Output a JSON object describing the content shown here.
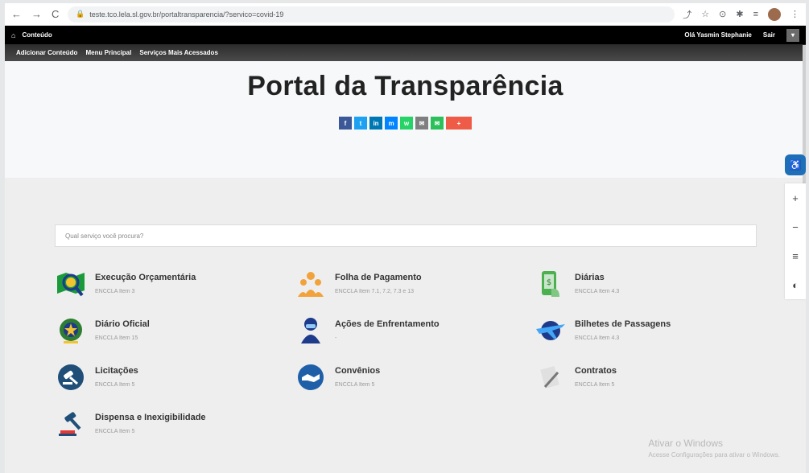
{
  "browser": {
    "back": "←",
    "forward": "→",
    "reload": "C",
    "lock": "🔒",
    "url": "teste.tco.lela.sl.gov.br/portaltransparencia/?servico=covid-19",
    "tool_icons": [
      "⤴",
      "☆",
      "⊙",
      "✱",
      "≡"
    ],
    "menu": "⋮"
  },
  "adminbar": {
    "home_icon": "⌂",
    "conteudo": "Conteúdo",
    "greeting": "Olá Yasmin Stephanie",
    "sair": "Sair",
    "toggle": "▾"
  },
  "submenu": {
    "items": [
      "Adicionar Conteúdo",
      "Menu Principal",
      "Serviços Mais Acessados"
    ]
  },
  "hero": {
    "title": "Portal da Transparência",
    "share_buttons": [
      {
        "label": "f",
        "color": "#3b5998"
      },
      {
        "label": "t",
        "color": "#1da1f2"
      },
      {
        "label": "in",
        "color": "#0077b5"
      },
      {
        "label": "m",
        "color": "#0084ff"
      },
      {
        "label": "w",
        "color": "#25d366"
      },
      {
        "label": "✉",
        "color": "#7f7f7f"
      },
      {
        "label": "✉",
        "color": "#2cc05b"
      },
      {
        "label": "+",
        "color": "#ee5c47"
      }
    ]
  },
  "search": {
    "placeholder": "Qual serviço você procura?"
  },
  "services": [
    {
      "title": "Execução Orçamentária",
      "sub": "ENCCLA Item 3",
      "icon": "map-magnifier-icon",
      "color": "#1b9a3c"
    },
    {
      "title": "Folha de Pagamento",
      "sub": "ENCCLA Item 7.1, 7.2, 7.3 e 13",
      "icon": "people-group-icon",
      "color": "#f2a23a"
    },
    {
      "title": "Diárias",
      "sub": "ENCCLA Item 4.3",
      "icon": "mobile-money-icon",
      "color": "#4caf50"
    },
    {
      "title": "Diário Oficial",
      "sub": "ENCCLA Item 15",
      "icon": "coat-of-arms-icon",
      "color": "#2e7d32"
    },
    {
      "title": "Ações de Enfrentamento",
      "sub": "-",
      "icon": "masked-person-icon",
      "color": "#1e3a8a"
    },
    {
      "title": "Bilhetes de Passagens",
      "sub": "ENCCLA Item 4.3",
      "icon": "airplane-globe-icon",
      "color": "#1565c0"
    },
    {
      "title": "Licitações",
      "sub": "ENCCLA Item 5",
      "icon": "gavel-circle-icon",
      "color": "#1f4e79"
    },
    {
      "title": "Convênios",
      "sub": "ENCCLA Item 5",
      "icon": "handshake-icon",
      "color": "#1f5fa8"
    },
    {
      "title": "Contratos",
      "sub": "ENCCLA Item 5",
      "icon": "contract-pen-icon",
      "color": "#999999"
    },
    {
      "title": "Dispensa e Inexigibilidade",
      "sub": "ENCCLA Item 5",
      "icon": "gavel-icon",
      "color": "#1f4e79"
    }
  ],
  "watermark": {
    "line1": "Ativar o Windows",
    "line2": "Acesse Configurações para ativar o Windows."
  },
  "accessibility": {
    "main_icon": "♿",
    "buttons": [
      "+",
      "−",
      "≡",
      "◐"
    ]
  }
}
